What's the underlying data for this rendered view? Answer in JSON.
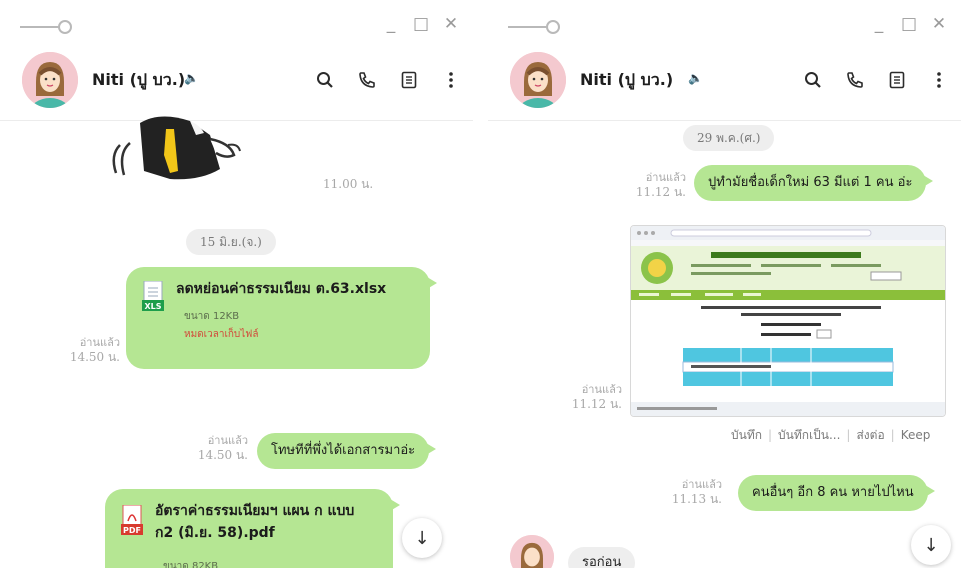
{
  "left_window": {
    "titlebar": {
      "min": "_",
      "max": "□",
      "close": "✕"
    },
    "header": {
      "name": "Niti (ปู บว.)",
      "mute_icon": "🔈"
    },
    "chat": {
      "sticker_time": "11.00 น.",
      "date_label": "15 มิ.ย.(จ.)",
      "file1": {
        "badge": "XLS",
        "name": "ลดหย่อนค่าธรรมเนียม ต.63.xlsx",
        "size": "ขนาด 12KB",
        "expired": "หมดเวลาเก็บไฟล์",
        "read": "อ่านแล้ว",
        "time": "14.50 น."
      },
      "msg1": {
        "text": "โทษทีที่พึ่งได้เอกสารมาอ่ะ",
        "read": "อ่านแล้ว",
        "time": "14.50 น."
      },
      "file2": {
        "badge": "PDF",
        "name_line1": "อัตราค่าธรรมเนียมฯ แผน ก แบบ",
        "name_line2": "ก2 (มิ.ย. 58).pdf",
        "size": "ขนาด 82KB"
      },
      "scroll_arrow": "↓"
    }
  },
  "right_window": {
    "titlebar": {
      "min": "_",
      "max": "□",
      "close": "✕"
    },
    "header": {
      "name": "Niti (ปู บว.)",
      "mute_icon": "🔈"
    },
    "chat": {
      "date_label": "29 พ.ค.(ศ.)",
      "msg1": {
        "text": "ปูทำมัยชื่อเด็กใหม่ 63 มีแต่ 1 คน อ่ะ",
        "read": "อ่านแล้ว",
        "time": "11.12 น."
      },
      "image": {
        "read": "อ่านแล้ว",
        "time": "11.12 น."
      },
      "image_actions": {
        "save": "บันทึก",
        "save_as": "บันทึกเป็น...",
        "share": "ส่งต่อ",
        "keep": "Keep"
      },
      "msg2": {
        "text": "คนอื่นๆ อีก 8 คน หายไปไหน",
        "read": "อ่านแล้ว",
        "time": "11.13 น."
      },
      "recv": {
        "text": "รอก่อน"
      },
      "scroll_arrow": "↓"
    }
  },
  "colors": {
    "bubble_sent": "#b5e693",
    "bubble_recv": "#eeeeee",
    "accent": "#06c755",
    "avatar_bg": "#f4c9cf"
  },
  "icons": [
    "search-icon",
    "phone-icon",
    "notes-icon",
    "more-icon",
    "mute-icon",
    "file-xls-icon",
    "file-pdf-icon",
    "arrow-down-icon"
  ]
}
